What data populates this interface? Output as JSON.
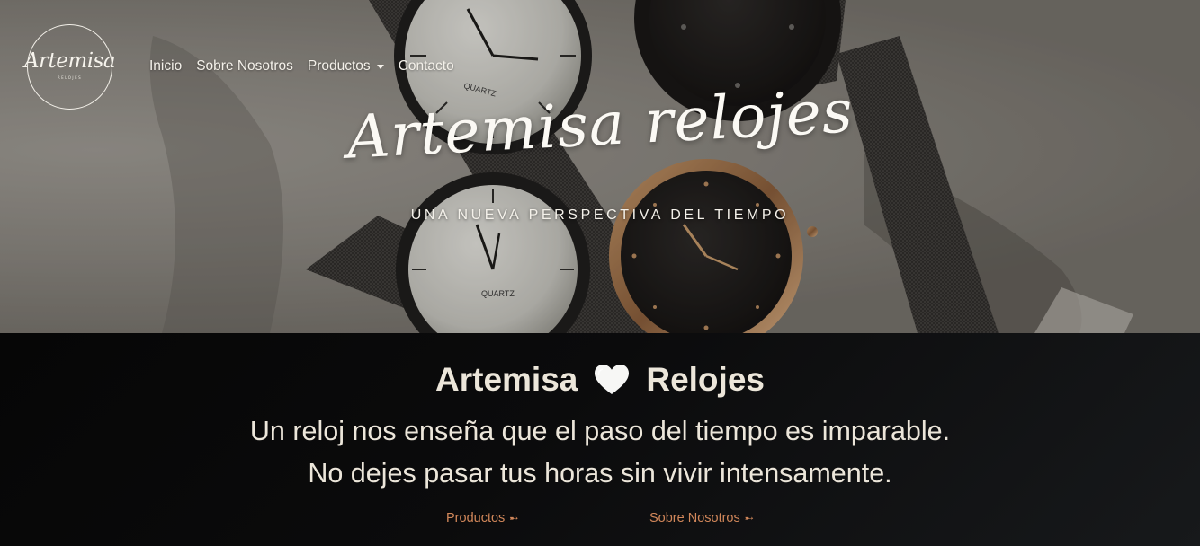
{
  "header": {
    "logo_text": "Artemisa",
    "logo_subtext": "RELOJES",
    "nav": [
      {
        "label": "Inicio"
      },
      {
        "label": "Sobre Nosotros"
      },
      {
        "label": "Productos",
        "has_dropdown": true
      },
      {
        "label": "Contacto"
      }
    ]
  },
  "hero": {
    "title": "Artemisa relojes",
    "subtitle": "UNA NUEVA PERSPECTIVA DEL TIEMPO"
  },
  "info": {
    "heading_left": "Artemisa",
    "heading_icon": "heart-icon",
    "heading_right": "Relojes",
    "line1": "Un reloj nos enseña que el paso del tiempo es imparable.",
    "line2": "No dejes pasar tus horas sin vivir intensamente.",
    "links": [
      {
        "label": "Productos",
        "icon": "arrow-right-icon"
      },
      {
        "label": "Sobre Nosotros",
        "icon": "arrow-right-icon"
      }
    ]
  },
  "colors": {
    "nav_text": "#f4f1ea",
    "link_accent": "#d1875a",
    "section_bg": "#0b0b0c",
    "heading_text": "#ece6da"
  }
}
